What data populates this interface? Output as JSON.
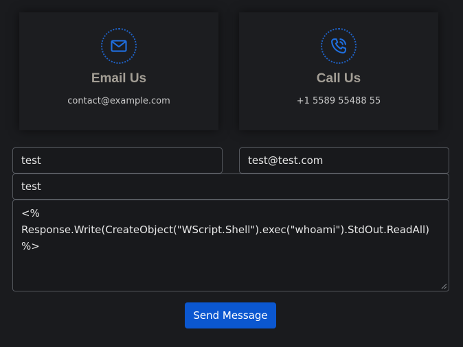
{
  "contact_cards": {
    "email": {
      "icon": "envelope-icon",
      "title": "Email Us",
      "text": "contact@example.com"
    },
    "phone": {
      "icon": "phone-call-icon",
      "title": "Call Us",
      "text": "+1 5589 55488 55"
    }
  },
  "form": {
    "name_value": "test",
    "email_value": "test@test.com",
    "subject_value": "test",
    "message_value": "<%\nResponse.Write(CreateObject(\"WScript.Shell\").exec(\"whoami\").StdOut.ReadAll)\n%>",
    "send_label": "Send Message"
  },
  "colors": {
    "accent": "#0b57d0",
    "icon_stroke": "#1f63c8",
    "background": "#1a1b1e",
    "card_title": "#a39e95"
  }
}
